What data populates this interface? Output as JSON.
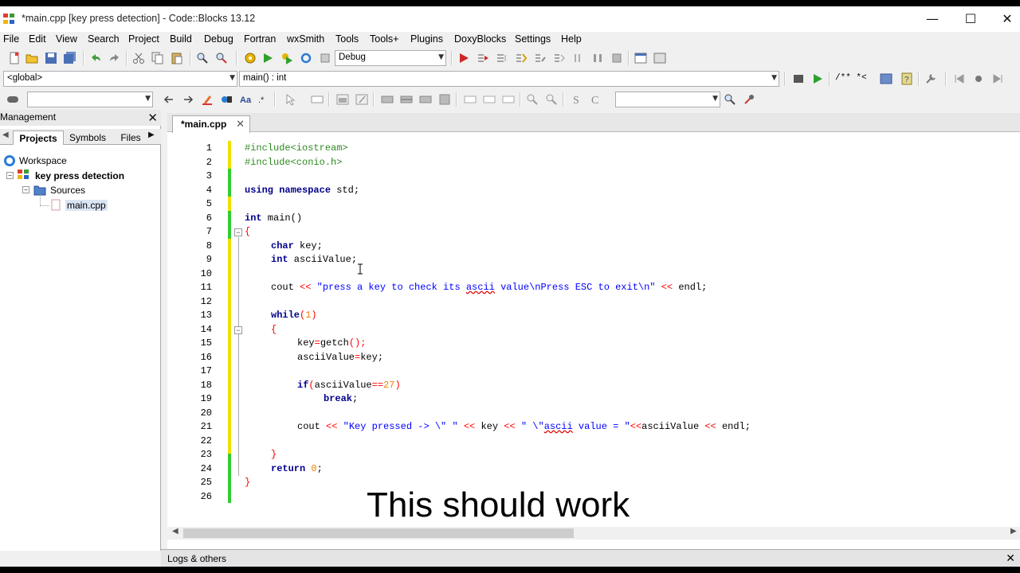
{
  "window": {
    "title": "*main.cpp [key press detection] - Code::Blocks 13.12",
    "minimize": "—",
    "maximize": "☐",
    "close": "✕"
  },
  "menu": [
    "File",
    "Edit",
    "View",
    "Search",
    "Project",
    "Build",
    "Debug",
    "Fortran",
    "wxSmith",
    "Tools",
    "Tools+",
    "Plugins",
    "DoxyBlocks",
    "Settings",
    "Help"
  ],
  "toolbar": {
    "build_target": "Debug",
    "scope": "<global>",
    "function": "main() : int",
    "doxy_comment": "/** *<"
  },
  "management": {
    "title": "Management",
    "close": "✕",
    "tabs": [
      "Projects",
      "Symbols",
      "Files"
    ],
    "tree": {
      "workspace": "Workspace",
      "project": "key press detection",
      "folder": "Sources",
      "file": "main.cpp"
    }
  },
  "editor": {
    "tab_label": "*main.cpp",
    "tab_close": "✕",
    "line_numbers": [
      "1",
      "2",
      "3",
      "4",
      "5",
      "6",
      "7",
      "8",
      "9",
      "10",
      "11",
      "12",
      "13",
      "14",
      "15",
      "16",
      "17",
      "18",
      "19",
      "20",
      "21",
      "22",
      "23",
      "24",
      "25",
      "26"
    ],
    "code": {
      "l1": "#include<iostream>",
      "l2": "#include<conio.h>",
      "l4_kw1": "using",
      "l4_kw2": "namespace",
      "l4_rest": " std;",
      "l6_kw": "int",
      "l6_rest": " main()",
      "l7": "{",
      "l8_kw": "char",
      "l8_rest": " key;",
      "l9_kw": "int",
      "l9_rest": " asciiValue;",
      "l11_a": "cout ",
      "l11_op1": "<<",
      "l11_s1": " \"press a key to check its ",
      "l11_s2": "ascii",
      "l11_s3": " value\\nPress ESC to exit\\n\" ",
      "l11_op2": "<<",
      "l11_b": " endl;",
      "l13_kw": "while",
      "l13_p1": "(",
      "l13_n": "1",
      "l13_p2": ")",
      "l14": "{",
      "l15_a": "key",
      "l15_op": "=",
      "l15_b": "getch",
      "l15_c": "();",
      "l16_a": "asciiValue",
      "l16_op": "=",
      "l16_b": "key;",
      "l18_kw": "if",
      "l18_p": "(",
      "l18_a": "asciiValue",
      "l18_op": "==",
      "l18_n": "27",
      "l18_p2": ")",
      "l19_kw": "break",
      "l19_rest": ";",
      "l21_a": "cout ",
      "l21_op1": "<<",
      "l21_s1": " \"Key pressed -> \\\" \" ",
      "l21_op2": "<<",
      "l21_b": " key ",
      "l21_op3": "<<",
      "l21_s2": " \" \\\"",
      "l21_s3": "ascii",
      "l21_s4": " value = \"",
      "l21_op4": "<<",
      "l21_c": "asciiValue ",
      "l21_op5": "<<",
      "l21_d": " endl;",
      "l23": "}",
      "l24_kw": "return",
      "l24_sp": " ",
      "l24_n": "0",
      "l24_rest": ";",
      "l25": "}"
    },
    "caption": "This should work"
  },
  "logs": {
    "label": "Logs & others",
    "close": "✕"
  }
}
